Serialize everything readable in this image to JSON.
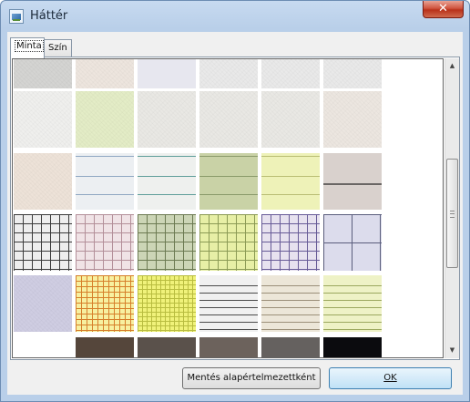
{
  "window": {
    "title": "Háttér",
    "close_glyph": "✕"
  },
  "tabs": [
    {
      "label": "Minta",
      "active": true
    },
    {
      "label": "Szín",
      "active": false
    }
  ],
  "buttons": {
    "save_default": "Mentés alapértelmezettként",
    "ok": "OK"
  },
  "scrollbar": {
    "up": "▲",
    "down": "▼"
  },
  "patterns": [
    [
      "plain-light-gray",
      "plain-peach",
      "plain-lavender",
      "plain-pale-gray",
      "plain-pale-gray",
      "plain-pale-gray"
    ],
    [
      "paper-white-texture",
      "plain-pale-green",
      "paper-light-texture",
      "paper-light-texture",
      "paper-light-texture",
      "paper-cream-texture"
    ],
    [
      "paper-peach-texture",
      "ruled-blue-lines",
      "ruled-teal-lines",
      "ruled-olive-lines",
      "ruled-yellow-lines",
      "ruled-gray-thick-line"
    ],
    [
      "grid-small-black",
      "grid-small-pink",
      "grid-small-green",
      "grid-small-yellow",
      "grid-small-purple",
      "grid-large-blue"
    ],
    [
      "paper-lavender-texture",
      "grid-orange-graph",
      "grid-yellow-fine",
      "lines-gray-stripes",
      "lines-beige-stripes",
      "lines-green-stripes"
    ],
    [
      "plain-white",
      "solid-dark-brown",
      "solid-dark-gray-brown",
      "solid-gray-brown",
      "solid-dark-gray",
      "solid-black"
    ]
  ]
}
